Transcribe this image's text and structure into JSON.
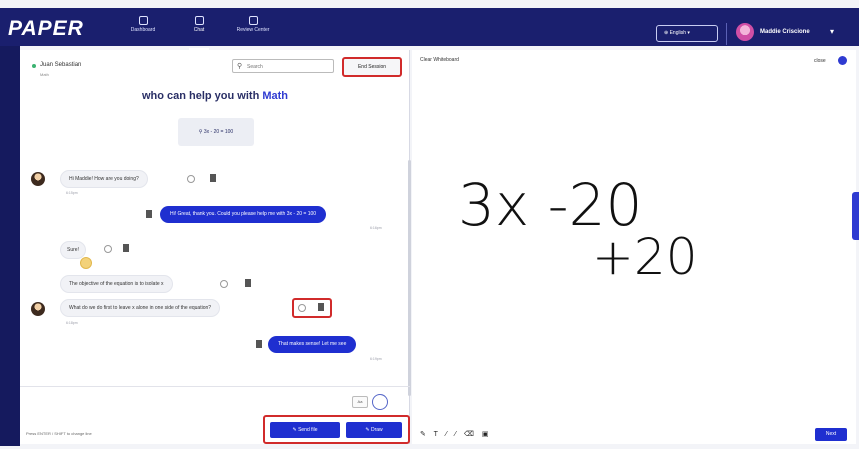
{
  "header": {
    "logo": "PAPER",
    "nav": [
      {
        "label": "Dashboard"
      },
      {
        "label": "Chat"
      },
      {
        "label": "Review Center"
      }
    ],
    "language": "English",
    "user_name": "Maddie Criscione",
    "user_caret": "▾"
  },
  "chat": {
    "tutor_name": "Juan Sebastian",
    "tutor_subtitle": "Math",
    "search_placeholder": "Search",
    "end_session": "End Session",
    "help_prefix": "who can help you with ",
    "help_subject": "Math",
    "equation": "3x - 20 = 100",
    "messages": [
      {
        "from": "tutor",
        "text": "Hi Maddie! How are you doing?",
        "time": "6:15pm"
      },
      {
        "from": "student",
        "text": "Hi! Great, thank you. Could you please help me with 3x - 20 = 100",
        "time": "6:16pm"
      },
      {
        "from": "tutor",
        "text": "Sure!"
      },
      {
        "from": "tutor",
        "text": "The objective of the equation is to isolate x"
      },
      {
        "from": "tutor",
        "text": "What do we do first to leave x alone in one side of the equation?",
        "time": "6:18pm"
      },
      {
        "from": "student",
        "text": "That makes sense! Let me see",
        "time": "6:19pm"
      }
    ],
    "composer_mini": "Aa",
    "footer_note": "Press ENTER / SHIFT to change line",
    "send_file": "Send file",
    "draw": "Draw"
  },
  "whiteboard": {
    "clear_label": "Clear Whiteboard",
    "close_label": "close",
    "line1": "3x -20",
    "line2": "+20",
    "tools": "✎ T ⁄ ⁄ ⌫ ▣",
    "next": "Next"
  }
}
